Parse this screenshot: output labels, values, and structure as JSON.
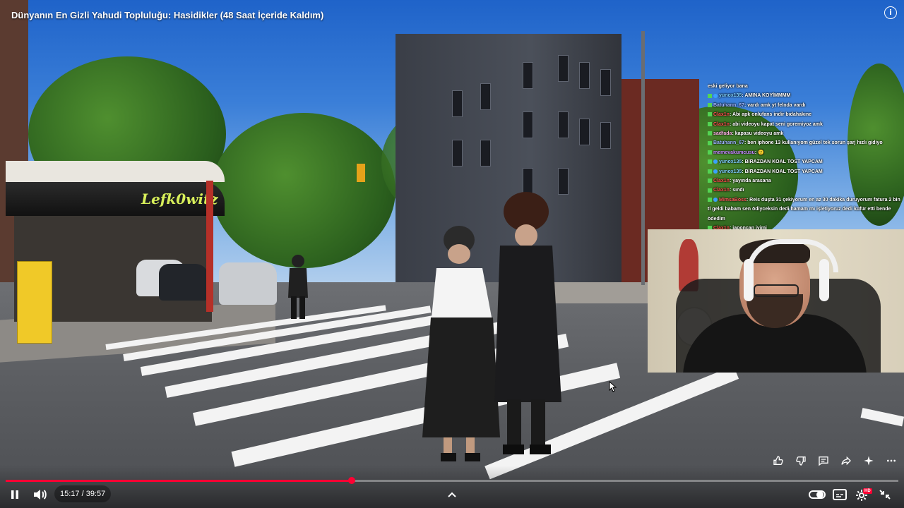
{
  "video": {
    "title": "Dünyanın En Gizli Yahudi Topluluğu: Hasidikler (48 Saat İçeride Kaldım)",
    "info_icon": "info-icon",
    "shop_sign": "Lefk0witz",
    "progress": 0.388,
    "time_current": "15:17",
    "time_total": "39:57",
    "time_display": "15:17 / 39:57",
    "accent_color": "#ff0033"
  },
  "chat": {
    "messages": [
      {
        "user": "",
        "text": "eski geliyor bana"
      },
      {
        "user": "yunox135",
        "text": ": AMINA KOYİMMMM"
      },
      {
        "user": "Batuhann_67",
        "text": ": vardı amk yt felnda vardı"
      },
      {
        "user": "Clax1n",
        "text": ": Abi apk onlufans indir bıdahakıne"
      },
      {
        "user": "Clax1n",
        "text": ": abi videoyu kapat seni goremiyoz amk"
      },
      {
        "user": "sadfada",
        "text": ": kapasu videoyu amk"
      },
      {
        "user": "Batuhann_67",
        "text": ": ben iphone 13 kullanıyom güzel tek sorun şarj hızlı gidiyo"
      },
      {
        "user": "memevakumcusu",
        "text": ": 🙂"
      },
      {
        "user": "yunox135",
        "text": ": BİRAZDAN KOAL TOST YAPCAM"
      },
      {
        "user": "yunox135",
        "text": ": BİRAZDAN KOAL TOST YAPCAM"
      },
      {
        "user": "Clax1n",
        "text": ": yayında arasana"
      },
      {
        "user": "Clax1n",
        "text": ": sındı"
      },
      {
        "user": "MimsaBoss",
        "text": ": Reis duşta 31 çekiyorum en az 30 dakika duruyorum fatura 2 bin tl geldi babam sen ödiyceksin dedi hamam mı işletiyoruz dedi küfür etti bende ödedim"
      },
      {
        "user": "Clax1n",
        "text": ": japoncan iyimi"
      }
    ],
    "user_colors": {
      "yunox135": "#7fd0ff",
      "Batuhann_67": "#9fb7ff",
      "Clax1n": "#ff4d4d",
      "sadfada": "#ffb4e6",
      "memevakumcusu": "#c78cff",
      "MimsaBoss": "#ff5b5b"
    }
  },
  "actions": {
    "like": "thumbs-up-icon",
    "dislike": "thumbs-down-icon",
    "comments": "comment-icon",
    "share": "share-icon",
    "ask": "sparkle-icon",
    "more": "more-icon"
  },
  "controls": {
    "pause": "pause-icon",
    "volume": "volume-icon",
    "chapters": "chevron-up-icon",
    "autoplay": "autoplay-toggle-icon",
    "subtitles": "subtitles-icon",
    "settings": "gear-icon",
    "settings_badge": "HD",
    "fullscreen": "exit-fullscreen-icon"
  }
}
